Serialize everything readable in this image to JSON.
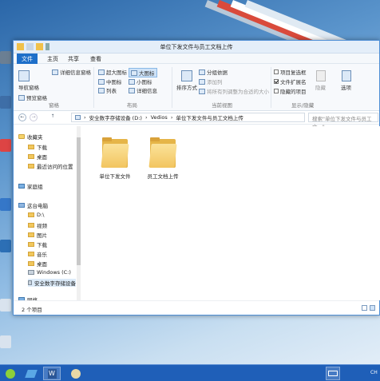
{
  "window": {
    "title": "单位下发文件与员工文档上传"
  },
  "tabs": [
    "文件",
    "主页",
    "共享",
    "查看"
  ],
  "ribbon": {
    "panes": {
      "nav_pane": "导航窗格",
      "preview_pane": "预览窗格",
      "details_pane": "详细信息窗格",
      "group_label": "窗格"
    },
    "layout": {
      "items": [
        "超大图标",
        "大图标",
        "中图标",
        "小图标",
        "列表",
        "详细信息"
      ],
      "group_label": "布局"
    },
    "current_view": {
      "sort_by": "排序方式",
      "group_by": "分组依据",
      "add_column": "添加列",
      "fit_columns": "将所有列调整为合适的大小",
      "group_label": "当前视图"
    },
    "show_hide": {
      "item_checkboxes": "项目复选框",
      "file_extensions": "文件扩展名",
      "hidden_items": "隐藏的项目",
      "hide_selected": "隐藏",
      "options": "选项",
      "group_label": "显示/隐藏"
    }
  },
  "address": {
    "back": "←",
    "forward": "→",
    "up": "↑",
    "path": [
      "安全数字存储设备 (D:)",
      "Vedios",
      "单位下发文件与员工文档上传"
    ],
    "search_placeholder": "搜索\"单位下发文件与员工文...\""
  },
  "nav": {
    "favorites": "收藏夹",
    "fav_items": [
      "下载",
      "桌面",
      "最近访问的位置"
    ],
    "homegroup": "家庭组",
    "this_pc": "这台电脑",
    "pc_items": [
      "D:\\",
      "视频",
      "图片",
      "下载",
      "音乐",
      "桌面",
      "Windows (C:)",
      "安全数字存储设备"
    ],
    "network": "网络"
  },
  "files": [
    {
      "name": "单位下发文件"
    },
    {
      "name": "员工文档上传"
    }
  ],
  "status": {
    "count": "2 个项目"
  },
  "taskbar": {
    "clock": "CH"
  },
  "colors": {
    "accent": "#1e6fc9",
    "folder": "#f2c55f",
    "taskbar": "#1f5fb8"
  }
}
